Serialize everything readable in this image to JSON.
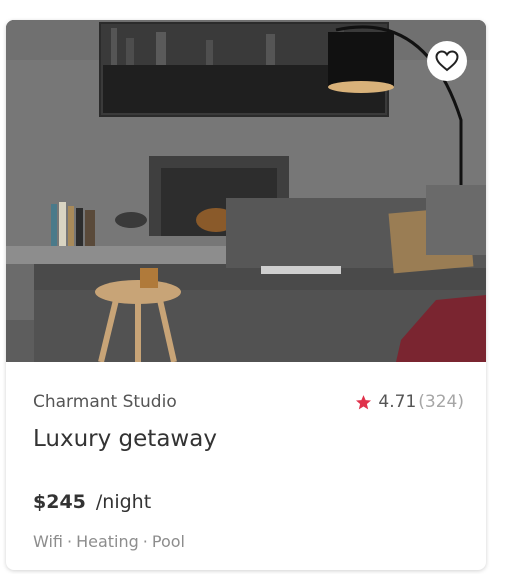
{
  "listing": {
    "subtitle": "Charmant Studio",
    "title": "Luxury getaway",
    "price": "$245",
    "price_unit": "/night",
    "rating": {
      "value": "4.71",
      "count": "(324)"
    },
    "amenities": [
      "Wifi",
      "Heating",
      "Pool"
    ],
    "amenity_separator": "·",
    "photo_icon": "living-room-photo",
    "favorite_icon": "heart-outline-icon",
    "rating_icon": "star-icon"
  },
  "colors": {
    "accent_star": "#e0324b",
    "text_primary": "#333333",
    "text_secondary": "#555555",
    "text_muted": "#8d8d8d",
    "card_background": "#ffffff"
  }
}
